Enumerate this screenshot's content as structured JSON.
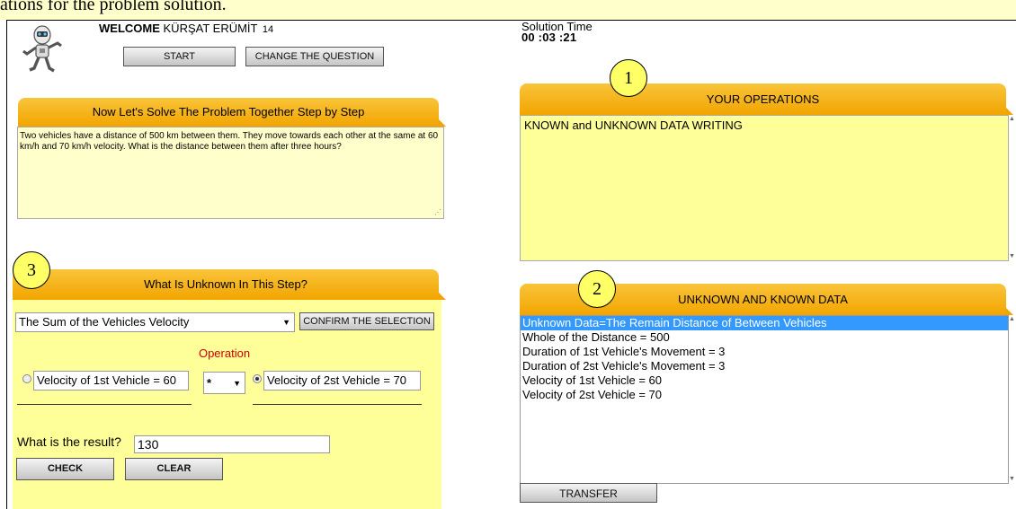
{
  "top_caption": "ations for the problem solution.",
  "header": {
    "welcome_bold": "WELCOME",
    "welcome_name": "KÜRŞAT ERÜMİT",
    "welcome_number": "14",
    "start_label": "START",
    "change_label": "CHANGE THE QUESTION"
  },
  "timer": {
    "label": "Solution Time",
    "value": "00 :03 :21"
  },
  "problem": {
    "header": "Now Let's Solve The Problem Together Step by Step",
    "text": "Two vehicles have a distance of 500 km between them. They move towards each other at the same at 60 km/h and 70 km/h velocity. What is the distance between them after three hours?"
  },
  "step": {
    "circle_number": "3",
    "header": "What Is Unknown In This Step?",
    "selected_unknown": "The Sum of the Vehicles Velocity",
    "confirm_label": "CONFIRM THE SELECTION",
    "operation_label": "Operation",
    "operand_1": "Velocity of 1st Vehicle = 60",
    "operator": "*",
    "operand_2": "Velocity of 2st Vehicle = 70",
    "result_label": "What is the result?",
    "result_value": "130",
    "check_label": "CHECK",
    "clear_label": "CLEAR"
  },
  "operations": {
    "circle_number": "1",
    "header": "YOUR OPERATIONS",
    "text": "KNOWN and UNKNOWN DATA WRITING"
  },
  "data_list": {
    "circle_number": "2",
    "header": "UNKNOWN AND KNOWN DATA",
    "items": [
      "Unknown Data=The Remain Distance of Between Vehicles",
      "Whole of the Distance = 500",
      "Duration of 1st Vehicle's Movement = 3",
      "Duration of 2st Vehicle's Movement = 3",
      "Velocity of 1st Vehicle = 60",
      "Velocity of 2st Vehicle = 70"
    ],
    "selected_index": 0,
    "transfer_label": "TRANSFER"
  },
  "colors": {
    "tab_orange": "#f2a500",
    "panel_yellow": "#ffff99",
    "box_pale": "#ffffcc",
    "selection_blue": "#3399ff",
    "operation_red": "#cc0000"
  }
}
